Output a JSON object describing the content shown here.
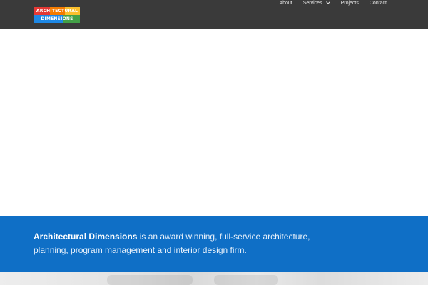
{
  "header": {
    "logo": {
      "line1": "ARCHITECTURAL",
      "line2": "DIMENSIONS",
      "colors": [
        "#e53935",
        "#f57c00",
        "#fbc02d",
        "#1e88e5",
        "#43a047"
      ]
    },
    "nav": [
      {
        "label": "About"
      },
      {
        "label": "Services",
        "icon": "chevron-down-icon"
      },
      {
        "label": "Projects"
      },
      {
        "label": "Contact"
      }
    ],
    "background": "#3a3a3a"
  },
  "intro": {
    "brand": "Architectural Dimensions",
    "text": " is an award winning, full-service architecture, planning, program management and interior design firm.",
    "background": "#0f6fc6"
  }
}
